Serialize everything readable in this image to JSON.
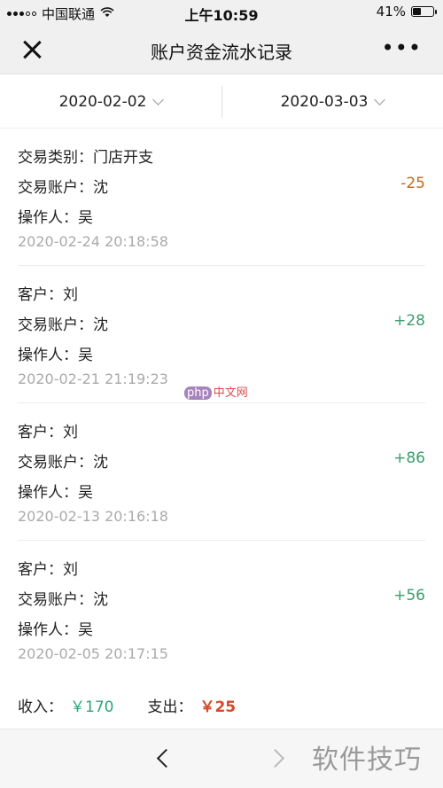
{
  "status_bar": {
    "carrier": "中国联通",
    "time": "上午10:59",
    "battery_text": "41%",
    "battery_level": 0.41
  },
  "nav": {
    "title": "账户资金流水记录",
    "more": "•••"
  },
  "filter": {
    "start_date": "2020-02-02",
    "end_date": "2020-03-03"
  },
  "records": [
    {
      "line1": "交易类别：门店开支",
      "line2": "交易账户：沈",
      "line3": "操作人：吴",
      "time": "2020-02-24 20:18:58",
      "amount": "-25",
      "sign": "neg"
    },
    {
      "line1": "客户：刘",
      "line2": "交易账户：沈",
      "line3": "操作人：吴",
      "time": "2020-02-21 21:19:23",
      "amount": "+28",
      "sign": "pos"
    },
    {
      "line1": "客户：刘",
      "line2": "交易账户：沈",
      "line3": "操作人：吴",
      "time": "2020-02-13 20:16:18",
      "amount": "+86",
      "sign": "pos"
    },
    {
      "line1": "客户：刘",
      "line2": "交易账户：沈",
      "line3": "操作人：吴",
      "time": "2020-02-05 20:17:15",
      "amount": "+56",
      "sign": "pos"
    }
  ],
  "summary": {
    "income_label": "收入：",
    "income_value": "￥170",
    "expense_label": "支出：",
    "expense_value": "￥25"
  },
  "watermarks": {
    "center": "php中文网",
    "center_logo": "php",
    "center_text": "中文网",
    "corner": "软件技巧"
  },
  "colors": {
    "negative": "#c06a1e",
    "positive": "#3a9e6c",
    "income": "#2aa57c",
    "expense": "#d44a2a"
  }
}
